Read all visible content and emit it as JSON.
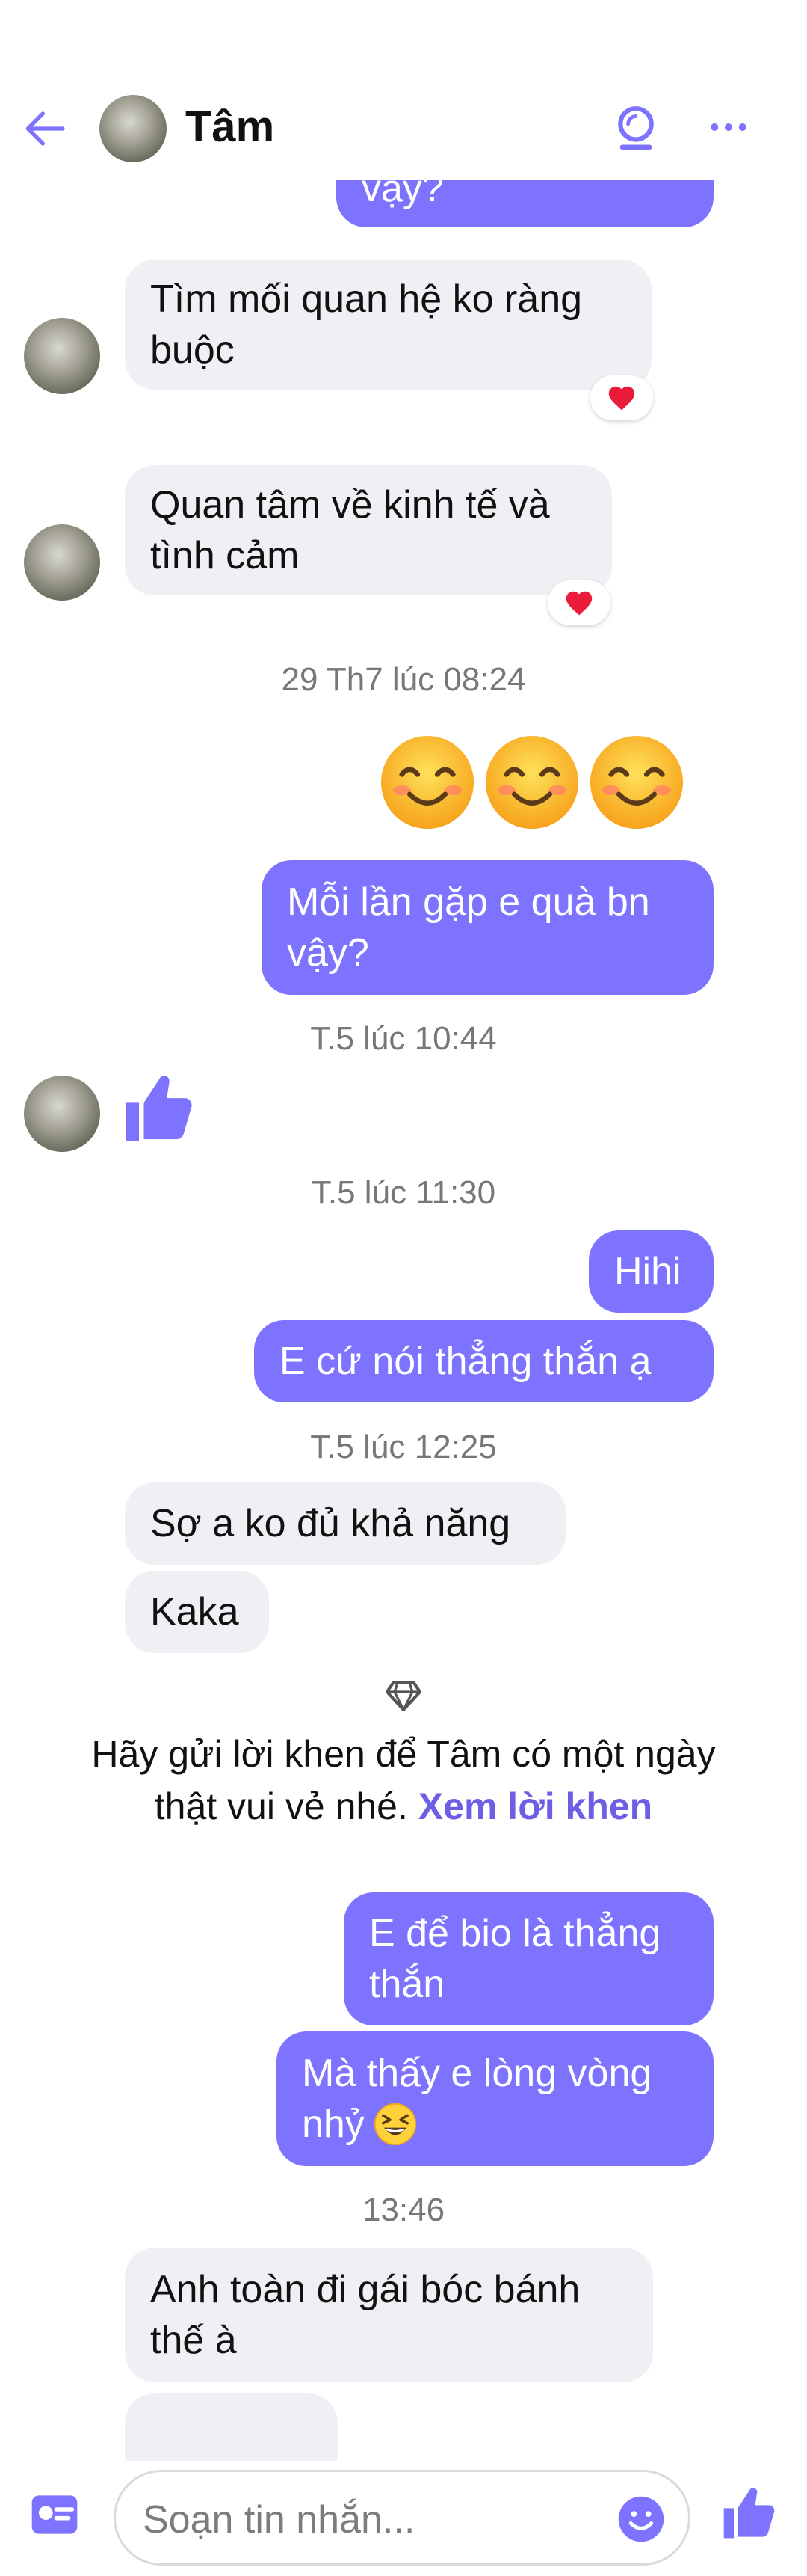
{
  "header": {
    "contact_name": "Tâm"
  },
  "messages": {
    "cut_top": "vậy?",
    "m1": [
      "Tìm mối quan hệ ko ràng",
      "buộc"
    ],
    "m2": [
      "Quan tâm về kinh tế và",
      "tình cảm"
    ],
    "ts1": "29 Th7 lúc 08:24",
    "m3": [
      "Mỗi lần gặp e quà bn",
      "vậy?"
    ],
    "ts2": "T.5 lúc 10:44",
    "ts3": "T.5 lúc 11:30",
    "m4": "Hihi",
    "m5": "E cứ nói thẳng thắn ạ",
    "ts4": "T.5 lúc 12:25",
    "m6": "Sợ a ko đủ khả năng",
    "m7": "Kaka",
    "m8": [
      "E để bio là thẳng",
      "thắn"
    ],
    "m9": [
      "Mà thấy e lòng vòng",
      "nhỷ"
    ],
    "ts5": "13:46",
    "m10": [
      "Anh toàn đi gái bóc bánh",
      "thế à"
    ]
  },
  "compliment": {
    "line1": "Hãy gửi lời khen để Tâm có một ngày",
    "line2": "thật vui vẻ nhé.",
    "link": "Xem lời khen"
  },
  "composer": {
    "placeholder": "Soạn tin nhắn..."
  },
  "icons": {
    "back": "arrow-left-icon",
    "call": "call-icon",
    "more": "more-icon",
    "heart": "heart-icon",
    "smile": "smiling-face-icon",
    "like": "thumbs-up-icon",
    "gem": "diamond-icon",
    "emoji": "emoji-icon",
    "card": "contact-card-icon"
  },
  "colors": {
    "accent": "#7e73ff",
    "incoming": "#eff0f4",
    "link": "#6c5fe6",
    "reaction_heart": "#ea1b3b"
  }
}
